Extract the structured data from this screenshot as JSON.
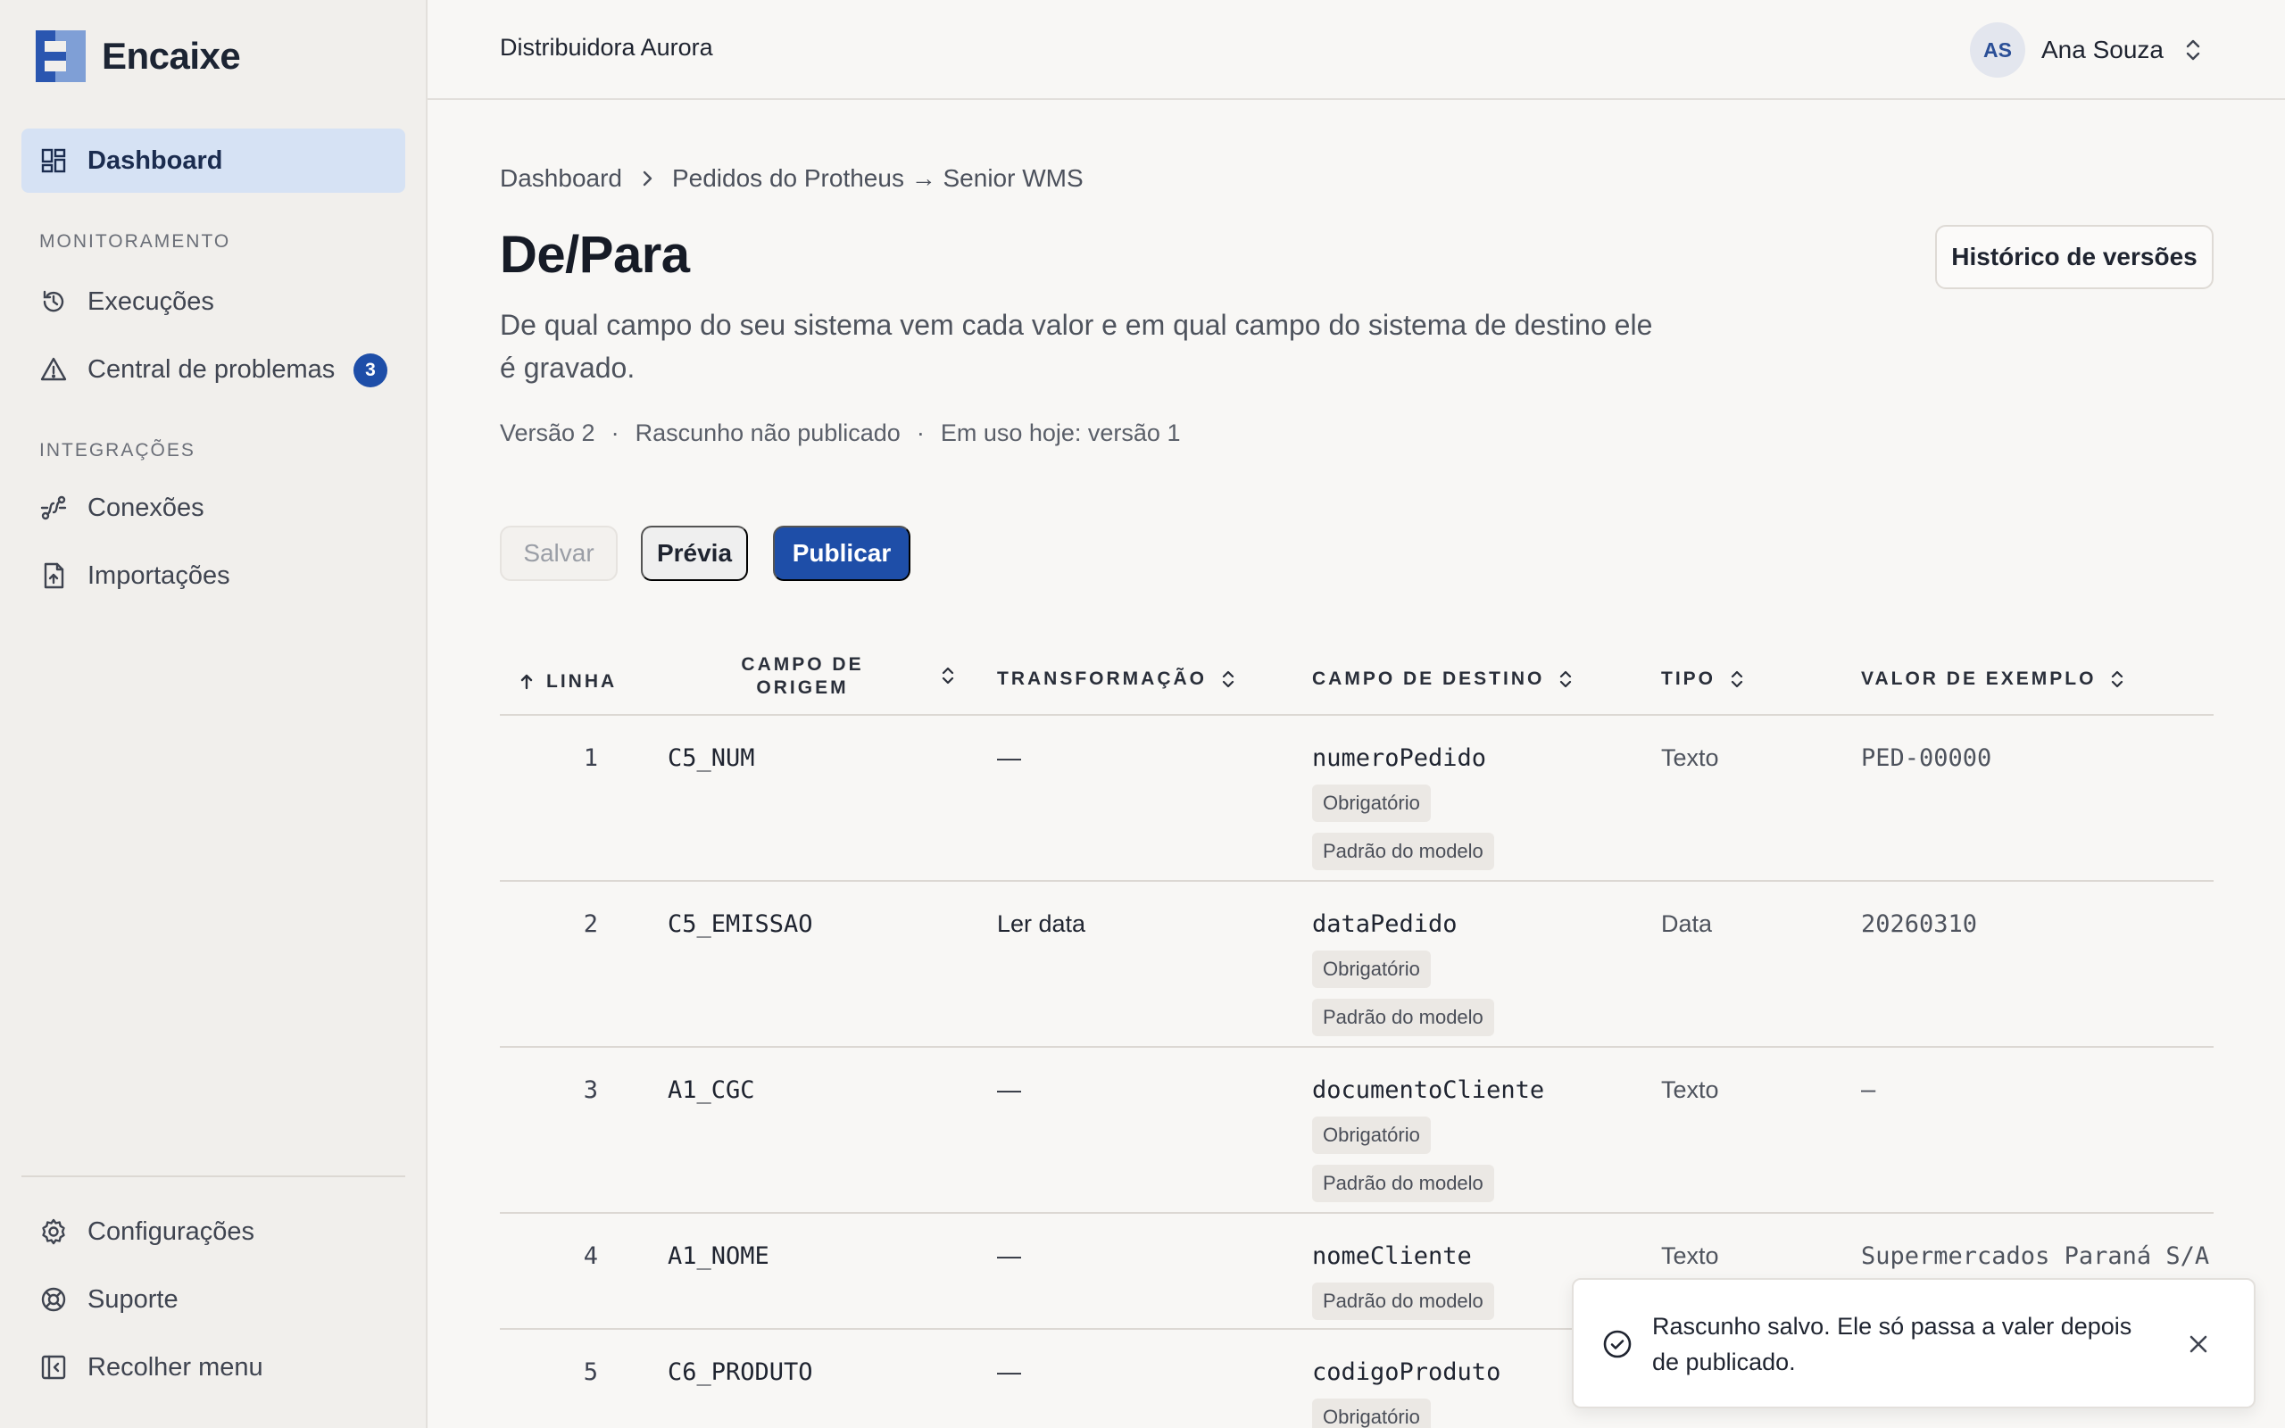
{
  "brand": {
    "name": "Encaixe"
  },
  "sidebar": {
    "dashboard": "Dashboard",
    "sections": {
      "monitoring": "MONITORAMENTO",
      "integrations": "INTEGRAÇÕES"
    },
    "items": {
      "executions": "Execuções",
      "problems": "Central de problemas",
      "problems_badge": "3",
      "connections": "Conexões",
      "imports": "Importações",
      "settings": "Configurações",
      "support": "Suporte",
      "collapse": "Recolher menu"
    }
  },
  "header": {
    "org": "Distribuidora Aurora",
    "user_initials": "AS",
    "user_name": "Ana Souza"
  },
  "breadcrumb": {
    "root": "Dashboard",
    "current": "Pedidos do Protheus → Senior WMS"
  },
  "page": {
    "title": "De/Para",
    "description": "De qual campo do seu sistema vem cada valor e em qual campo do sistema de destino ele é gravado.",
    "version": "Versão 2",
    "status": "Rascunho não publicado",
    "in_use": "Em uso hoje: versão 1",
    "history_button": "Histórico de versões"
  },
  "actions": {
    "save": "Salvar",
    "preview": "Prévia",
    "publish": "Publicar"
  },
  "table": {
    "headers": {
      "line": "LINHA",
      "source_1": "CAMPO DE",
      "source_2": "ORIGEM",
      "transform": "TRANSFORMAÇÃO",
      "dest": "CAMPO DE DESTINO",
      "type": "TIPO",
      "example": "VALOR DE EXEMPLO"
    },
    "rows": [
      {
        "line": "1",
        "source": "C5_NUM",
        "transform": "—",
        "dest": "numeroPedido",
        "tags": [
          "Obrigatório",
          "Padrão do modelo"
        ],
        "type": "Texto",
        "example": "PED-00000"
      },
      {
        "line": "2",
        "source": "C5_EMISSAO",
        "transform": "Ler data",
        "dest": "dataPedido",
        "tags": [
          "Obrigatório",
          "Padrão do modelo"
        ],
        "type": "Data",
        "example": "20260310"
      },
      {
        "line": "3",
        "source": "A1_CGC",
        "transform": "—",
        "dest": "documentoCliente",
        "tags": [
          "Obrigatório",
          "Padrão do modelo"
        ],
        "type": "Texto",
        "example": "—"
      },
      {
        "line": "4",
        "source": "A1_NOME",
        "transform": "—",
        "dest": "nomeCliente",
        "tags": [
          "Padrão do modelo"
        ],
        "type": "Texto",
        "example": "Supermercados Paraná S/A"
      },
      {
        "line": "5",
        "source": "C6_PRODUTO",
        "transform": "—",
        "dest": "codigoProduto",
        "tags": [
          "Obrigatório"
        ],
        "type": "",
        "example": ""
      }
    ]
  },
  "toast": {
    "message": "Rascunho salvo. Ele só passa a valer depois de publicado."
  },
  "colors": {
    "accent": "#1e4ea8",
    "active_nav_bg": "#d6e2f4",
    "sidebar_bg": "#f1efec",
    "page_bg": "#f8f7f5"
  }
}
